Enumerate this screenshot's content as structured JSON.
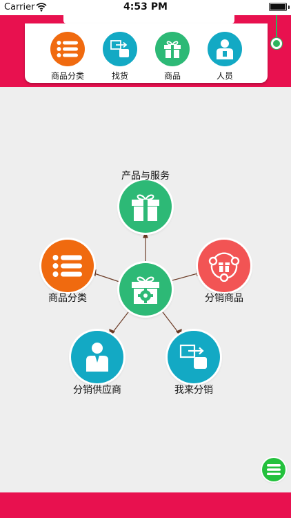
{
  "status_bar": {
    "carrier": "Carrier",
    "time": "4:53 PM"
  },
  "nav": [
    {
      "label": "商品分类",
      "icon": "list-icon",
      "color": "#f06a0f"
    },
    {
      "label": "找货",
      "icon": "transfer-icon",
      "color": "#13a9c4"
    },
    {
      "label": "商品",
      "icon": "gift-icon",
      "color": "#2db976"
    },
    {
      "label": "人员",
      "icon": "person-icon",
      "color": "#13a9c4"
    }
  ],
  "hub": {
    "center_icon": "gift-gear-icon",
    "center_color": "#2db976",
    "nodes": [
      {
        "label": "产品与服务",
        "icon": "gift-icon",
        "color": "#2db976"
      },
      {
        "label": "商品分类",
        "icon": "list-icon",
        "color": "#f06a0f"
      },
      {
        "label": "分销商品",
        "icon": "share-gift-icon",
        "color": "#f25454"
      },
      {
        "label": "分销供应商",
        "icon": "person-icon",
        "color": "#13a9c4"
      },
      {
        "label": "我来分销",
        "icon": "transfer-icon",
        "color": "#13a9c4"
      }
    ]
  },
  "theme": {
    "accent": "#e8114f",
    "fab": "#24c13d"
  }
}
